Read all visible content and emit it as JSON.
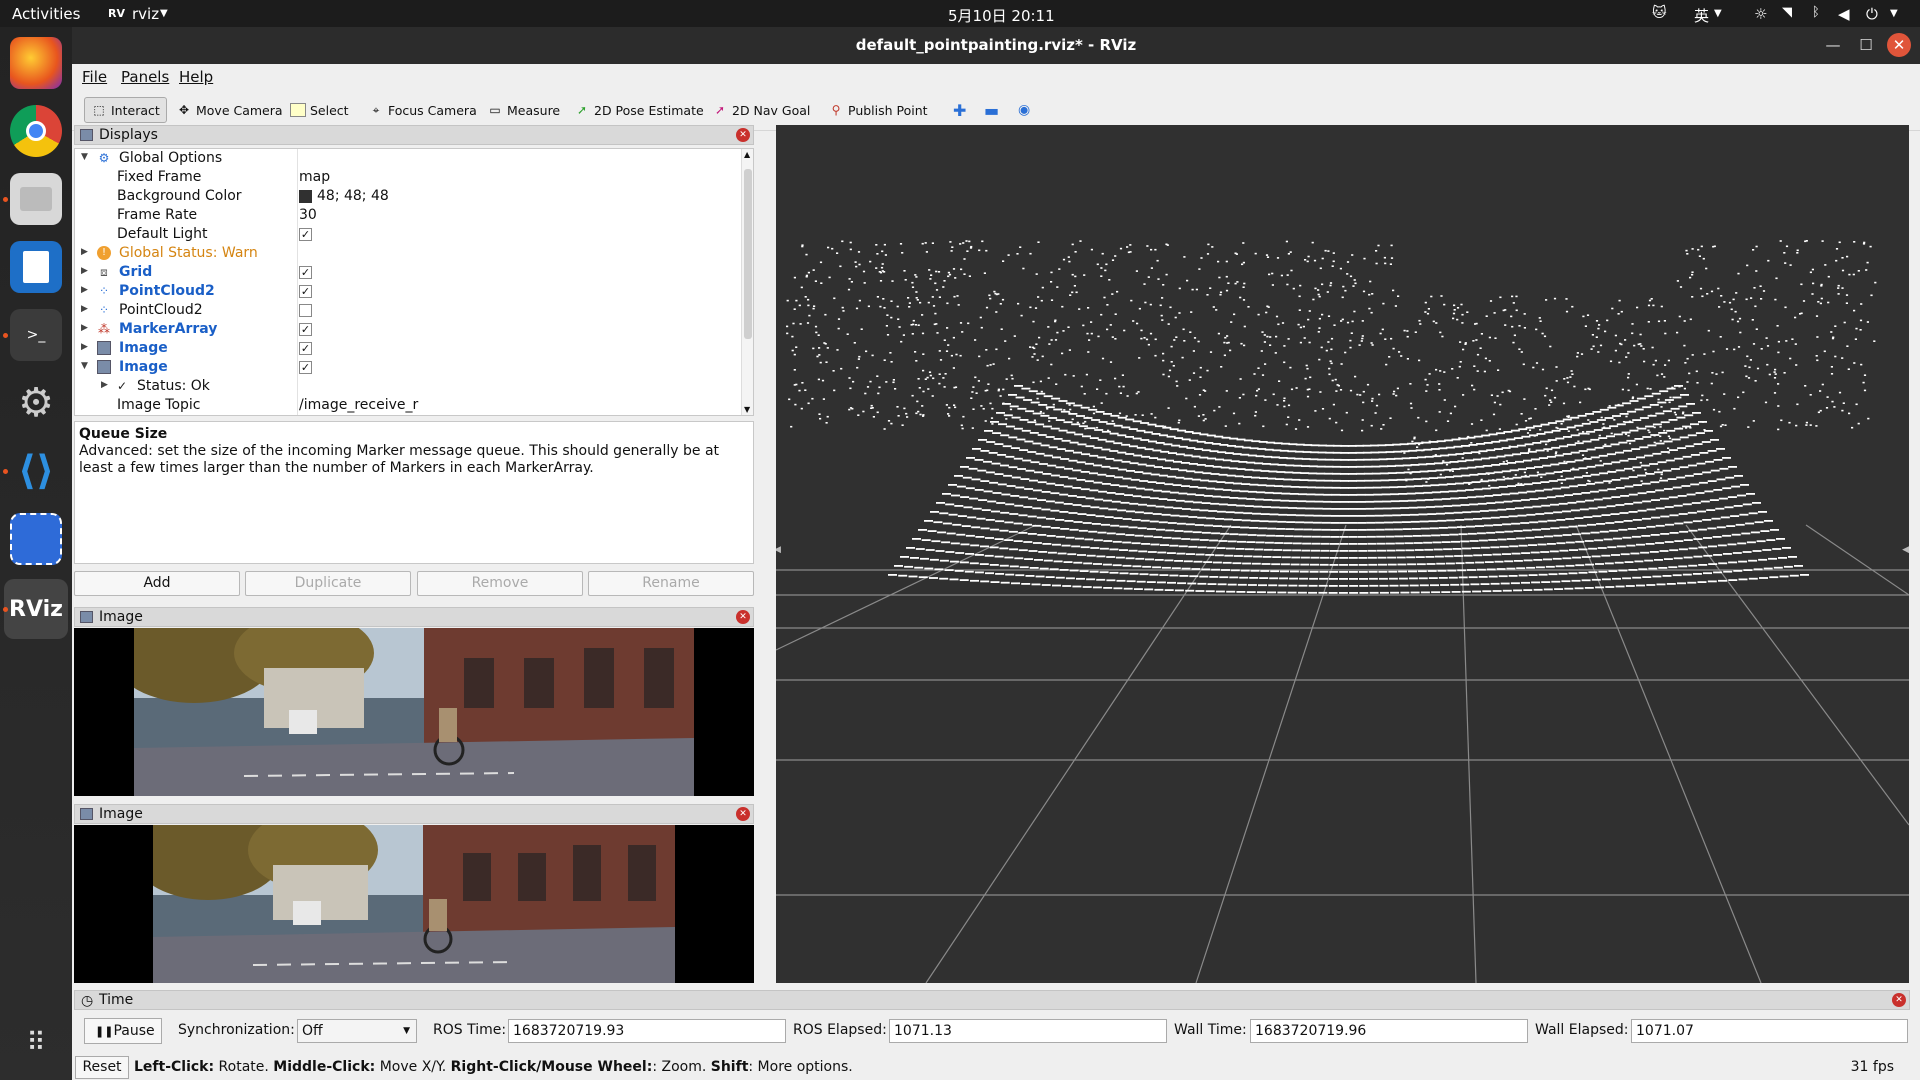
{
  "topbar": {
    "activities": "Activities",
    "app": "rviz",
    "app_icon": "rviz-icon",
    "clock": "5月10日  20:11",
    "ime": "英"
  },
  "window": {
    "title": "default_pointpainting.rviz* - RViz"
  },
  "menu": {
    "file": "File",
    "panels": "Panels",
    "help": "Help"
  },
  "toolbar": {
    "interact": "Interact",
    "move_camera": "Move Camera",
    "select": "Select",
    "focus_camera": "Focus Camera",
    "measure": "Measure",
    "pose_estimate": "2D Pose Estimate",
    "nav_goal": "2D Nav Goal",
    "publish_point": "Publish Point"
  },
  "displays": {
    "title": "Displays",
    "rows": [
      {
        "name": "Global Options",
        "value": ""
      },
      {
        "name": "Fixed Frame",
        "value": "map"
      },
      {
        "name": "Background Color",
        "value": "48; 48; 48"
      },
      {
        "name": "Frame Rate",
        "value": "30"
      },
      {
        "name": "Default Light",
        "value": "✓"
      },
      {
        "name": "Global Status: Warn",
        "value": ""
      },
      {
        "name": "Grid",
        "value": "✓"
      },
      {
        "name": "PointCloud2",
        "value": "✓"
      },
      {
        "name": "PointCloud2",
        "value": ""
      },
      {
        "name": "MarkerArray",
        "value": "✓"
      },
      {
        "name": "Image",
        "value": "✓"
      },
      {
        "name": "Image",
        "value": "✓"
      },
      {
        "name": "Status: Ok",
        "value": ""
      },
      {
        "name": "Image Topic",
        "value": "/image_receive_r"
      }
    ],
    "bg_color": "#303030"
  },
  "description": {
    "title": "Queue Size",
    "text": "Advanced: set the size of the incoming Marker message queue. This should generally be at least a few times larger than the number of Markers in each MarkerArray."
  },
  "buttons": {
    "add": "Add",
    "duplicate": "Duplicate",
    "remove": "Remove",
    "rename": "Rename"
  },
  "image_panels": [
    {
      "title": "Image"
    },
    {
      "title": "Image"
    }
  ],
  "time": {
    "title": "Time",
    "pause": "Pause",
    "sync_label": "Synchronization:",
    "sync_value": "Off",
    "ros_time_label": "ROS Time:",
    "ros_time": "1683720719.93",
    "ros_elapsed_label": "ROS Elapsed:",
    "ros_elapsed": "1071.13",
    "wall_time_label": "Wall Time:",
    "wall_time": "1683720719.96",
    "wall_elapsed_label": "Wall Elapsed:",
    "wall_elapsed": "1071.07"
  },
  "status": {
    "reset": "Reset",
    "b1": "Left-Click:",
    "t1": " Rotate. ",
    "b2": "Middle-Click:",
    "t2": " Move X/Y. ",
    "b3": "Right-Click/Mouse Wheel:",
    "t3": ": Zoom. ",
    "b4": "Shift",
    "t4": ": More options.",
    "fps": "31 fps"
  }
}
